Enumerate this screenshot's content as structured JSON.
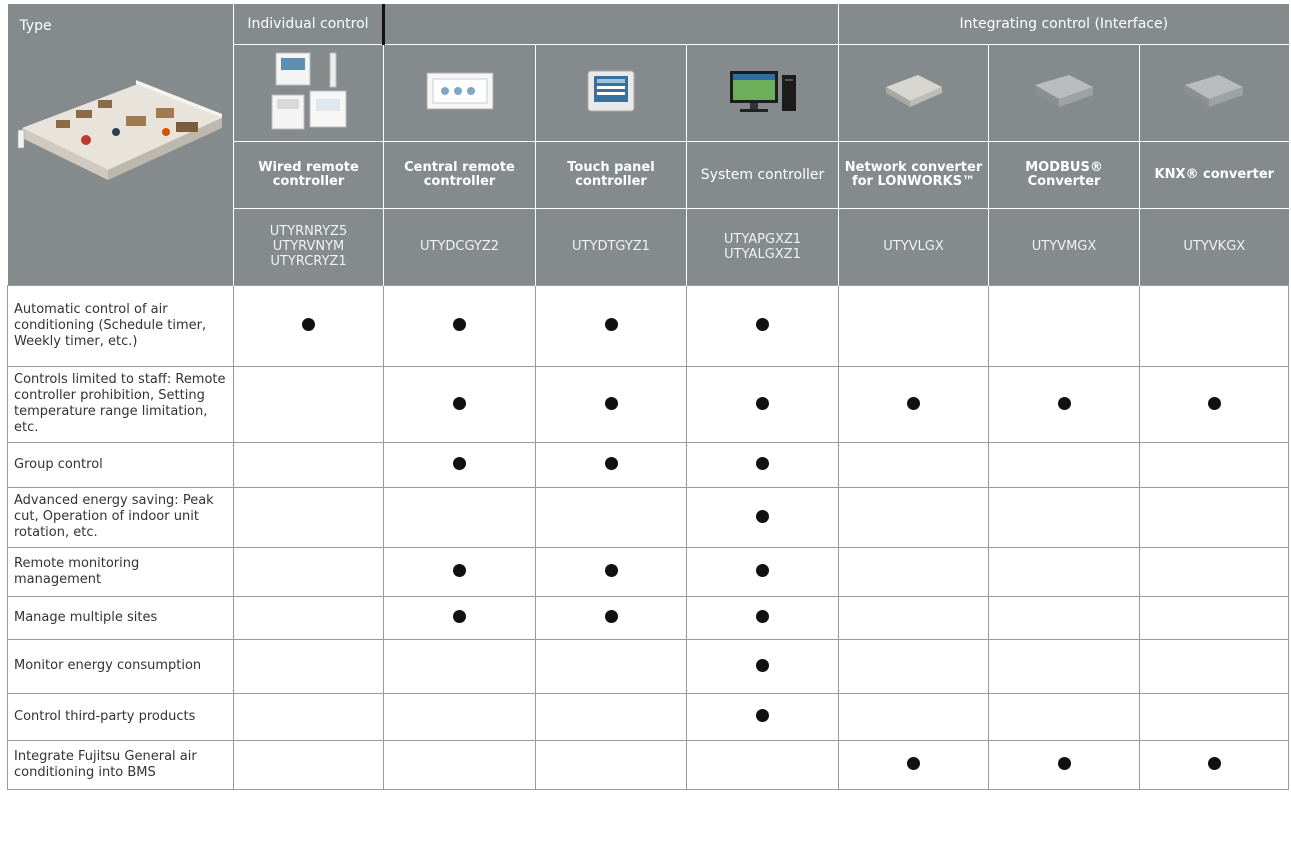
{
  "header": {
    "type_label": "Type",
    "group_individual": "Individual control",
    "group_integrating": "Integrating control (Interface)"
  },
  "products": [
    {
      "name": "Wired remote controller",
      "code": "UTYRNRYZ5\nUTYRVNYM\nUTYRCRYZ1"
    },
    {
      "name": "Central remote controller",
      "code": "UTYDCGYZ2"
    },
    {
      "name": "Touch panel controller",
      "code": "UTYDTGYZ1"
    },
    {
      "name": "System controller",
      "code": "UTYAPGXZ1\nUTYALGXZ1"
    },
    {
      "name": "Network converter for LONWORKS™",
      "code": "UTYVLGX"
    },
    {
      "name": "MODBUS® Converter",
      "code": "UTYVMGX"
    },
    {
      "name": "KNX® converter",
      "code": "UTYVKGX"
    }
  ],
  "rows": [
    {
      "label": "Automatic control of air conditioning (Schedule timer, Weekly timer, etc.)",
      "marks": [
        1,
        1,
        1,
        1,
        0,
        0,
        0
      ]
    },
    {
      "label": "Controls limited to staff: Remote controller prohibition, Setting temperature range limitation, etc.",
      "marks": [
        0,
        1,
        1,
        1,
        1,
        1,
        1
      ]
    },
    {
      "label": "Group control",
      "marks": [
        0,
        1,
        1,
        1,
        0,
        0,
        0
      ]
    },
    {
      "label": "Advanced energy saving: Peak cut, Operation of indoor unit rotation, etc.",
      "marks": [
        0,
        0,
        0,
        1,
        0,
        0,
        0
      ]
    },
    {
      "label": "Remote monitoring management",
      "marks": [
        0,
        1,
        1,
        1,
        0,
        0,
        0
      ]
    },
    {
      "label": "Manage multiple sites",
      "marks": [
        0,
        1,
        1,
        1,
        0,
        0,
        0
      ]
    },
    {
      "label": "Monitor energy consumption",
      "marks": [
        0,
        0,
        0,
        1,
        0,
        0,
        0
      ]
    },
    {
      "label": "Control third-party products",
      "marks": [
        0,
        0,
        0,
        1,
        0,
        0,
        0
      ]
    },
    {
      "label": "Integrate Fujitsu General air conditioning into BMS",
      "marks": [
        0,
        0,
        0,
        0,
        1,
        1,
        1
      ]
    }
  ],
  "colors": {
    "header_bg": "#858a8d",
    "header_text": "#ffffff",
    "mark": "#111111"
  },
  "icons": [
    "building-cutaway-illustration",
    "wired-remote-controllers-image",
    "central-remote-controller-image",
    "touch-panel-controller-image",
    "system-controller-pc-image",
    "network-converter-box-image",
    "modbus-converter-box-image",
    "knx-converter-box-image"
  ]
}
